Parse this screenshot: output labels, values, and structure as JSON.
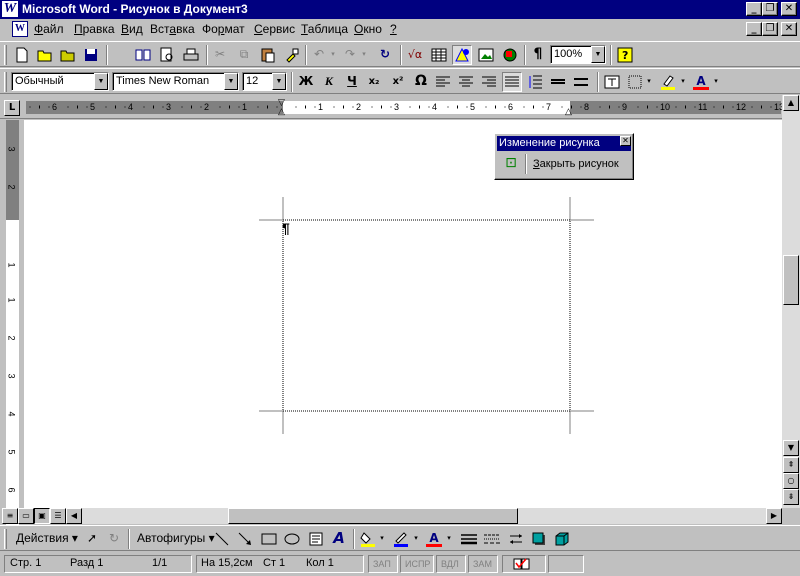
{
  "window": {
    "title": "Microsoft Word - Рисунок в Документ3",
    "app_icon": "W"
  },
  "caption": {
    "minimize": "_",
    "restore": "❐",
    "close": "✕"
  },
  "menu": {
    "doc_icon": "W",
    "items": [
      {
        "pre": "",
        "u": "Ф",
        "post": "айл"
      },
      {
        "pre": "",
        "u": "П",
        "post": "равка"
      },
      {
        "pre": "",
        "u": "В",
        "post": "ид"
      },
      {
        "pre": "Вст",
        "u": "а",
        "post": "вка"
      },
      {
        "pre": "Фо",
        "u": "р",
        "post": "мат"
      },
      {
        "pre": "",
        "u": "С",
        "post": "ервис"
      },
      {
        "pre": "",
        "u": "Т",
        "post": "аблица"
      },
      {
        "pre": "",
        "u": "О",
        "post": "кно"
      },
      {
        "pre": "",
        "u": "?",
        "post": ""
      }
    ]
  },
  "standard": {
    "zoom": "100%",
    "pilcrow": "¶",
    "help": "?"
  },
  "formatting": {
    "style": "Обычный",
    "font": "Times New Roman",
    "size": "12",
    "bold": "Ж",
    "italic": "К",
    "underline": "Ч",
    "subscript": "x₂",
    "superscript": "x²",
    "symbol": "Ω"
  },
  "ruler": {
    "left": [
      "6",
      "5",
      "4",
      "3",
      "2",
      "1"
    ],
    "right": [
      "1",
      "2",
      "3",
      "4",
      "5",
      "6",
      "7",
      "8",
      "9",
      "10",
      "11",
      "12",
      "13"
    ]
  },
  "vruler": {
    "labels": [
      "3",
      "2",
      "1",
      "1",
      "2",
      "3",
      "4",
      "5",
      "6",
      "7"
    ]
  },
  "edit_picture": {
    "title": "Изменение рисунка",
    "reset_icon": "⊡",
    "close_label": "Закрыть рисунок",
    "close_u": "З",
    "close_rest": "акрыть рисунок"
  },
  "document": {
    "pilcrow": "¶"
  },
  "drawing": {
    "actions": "Действия",
    "autoshapes": "Автофигуры",
    "font_a": "A"
  },
  "status": {
    "page": "Стр. 1",
    "section": "Разд 1",
    "pages": "1/1",
    "at": "На 15,2см",
    "line": "Ст 1",
    "col": "Кол 1",
    "rec": "ЗАП",
    "trk": "ИСПР",
    "ext": "ВДЛ",
    "ovr": "ЗАМ"
  },
  "colors": {
    "title_bg": "#000080",
    "highlight": "#ffff00",
    "font_color": "#ff0000",
    "line_color": "#0000ff",
    "fill_color": "#ffff00"
  }
}
